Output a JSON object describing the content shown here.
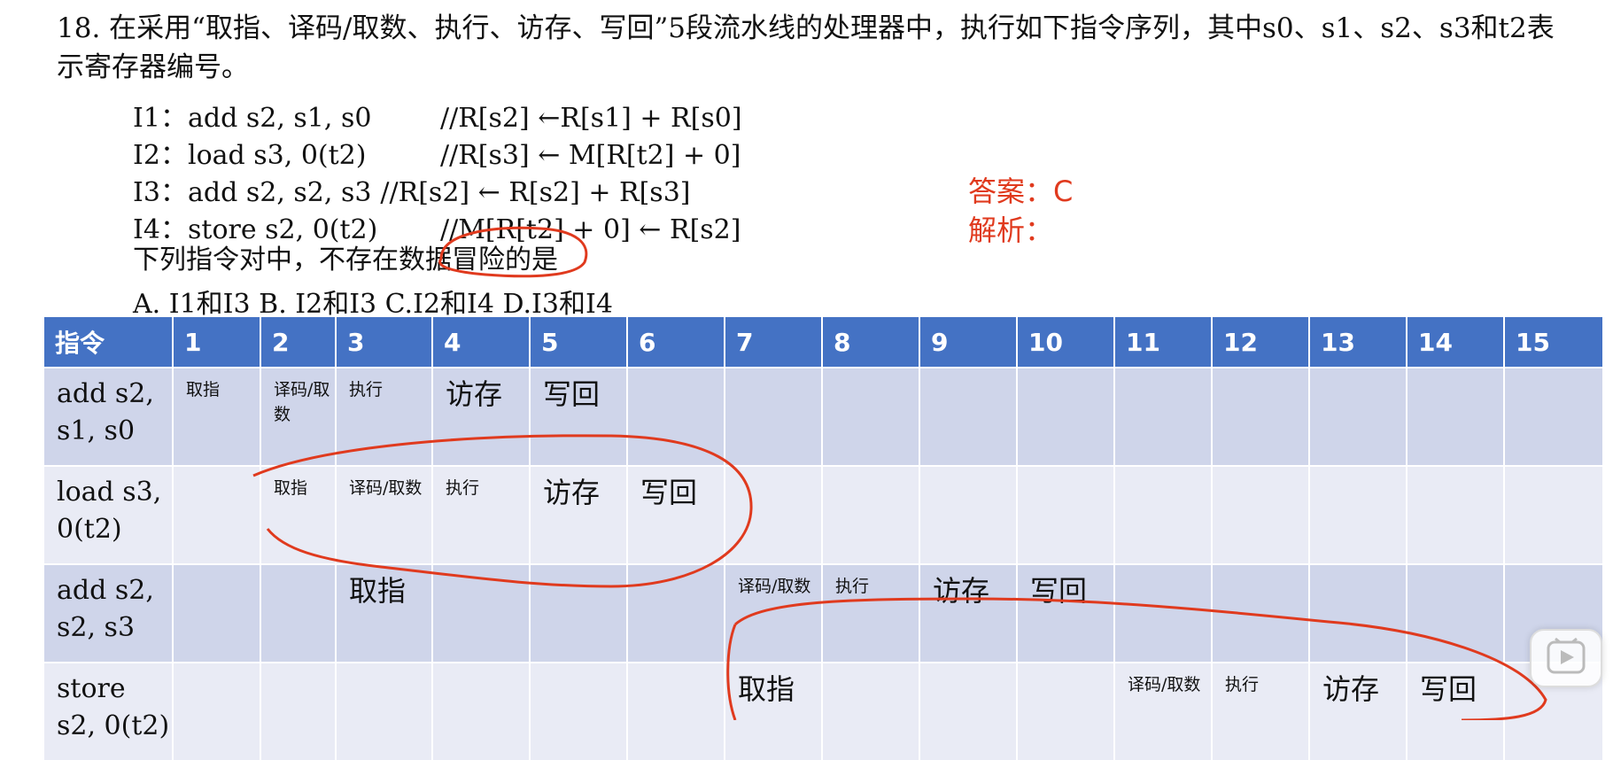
{
  "question": {
    "text": "18. 在采用“取指、译码/取数、执行、访存、写回”5段流水线的处理器中，执行如下指令序列，其中s0、s1、s2、s3和t2表示寄存器编号。",
    "code_lines": [
      {
        "label": "I1：",
        "instr": "add s2, s1, s0",
        "comment": "//R[s2] ←R[s1] + R[s0]"
      },
      {
        "label": "I2：",
        "instr": "load s3, 0(t2)",
        "comment": "//R[s3] ← M[R[t2] + 0]"
      },
      {
        "label": "I3：",
        "instr": "add s2, s2, s3",
        "comment": "//R[s2] ← R[s2] + R[s3]"
      },
      {
        "label": "I4：",
        "instr": "store s2, 0(t2)",
        "comment": "//M[R[t2] + 0] ← R[s2]"
      }
    ],
    "stem": "下列指令对中，不存在数据冒险的是",
    "options": "A. I1和I3  B. I2和I3  C.I2和I4  D.I3和I4"
  },
  "answer": {
    "line1": "答案：C",
    "line2": "解析："
  },
  "table": {
    "headers": [
      "指令",
      "1",
      "2",
      "3",
      "4",
      "5",
      "6",
      "7",
      "8",
      "9",
      "10",
      "11",
      "12",
      "13",
      "14",
      "15"
    ],
    "rows": [
      {
        "label": "add s2, s1, s0",
        "cells": [
          "取指",
          "译码/取数",
          "执行",
          "访存",
          "写回",
          "",
          "",
          "",
          "",
          "",
          "",
          "",
          "",
          "",
          ""
        ]
      },
      {
        "label": "load s3, 0(t2)",
        "cells": [
          "",
          "取指",
          "译码/取数",
          "执行",
          "访存",
          "写回",
          "",
          "",
          "",
          "",
          "",
          "",
          "",
          "",
          ""
        ]
      },
      {
        "label": "add s2, s2, s3",
        "cells": [
          "",
          "",
          "取指",
          "",
          "",
          "",
          "译码/取数",
          "执行",
          "访存",
          "写回",
          "",
          "",
          "",
          "",
          ""
        ]
      },
      {
        "label": "store s2, 0(t2)",
        "cells": [
          "",
          "",
          "",
          "",
          "",
          "",
          "取指",
          "",
          "",
          "",
          "译码/取数",
          "执行",
          "访存",
          "写回",
          ""
        ]
      }
    ]
  },
  "colors": {
    "header_bg": "#4472c4",
    "row_dark": "#cfd5ea",
    "row_light": "#e9ebf5",
    "annotation_red": "#e03a1e"
  },
  "icons": [
    "play-icon"
  ]
}
